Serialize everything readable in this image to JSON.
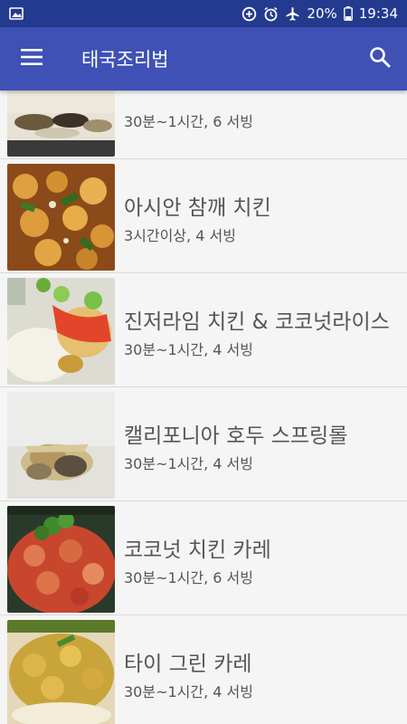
{
  "status_bar": {
    "battery": "20%",
    "time": "19:34",
    "icons": [
      "image-icon",
      "data-saver-icon",
      "alarm-icon",
      "airplane-icon",
      "battery-icon"
    ]
  },
  "app_bar": {
    "title": "태국조리법",
    "icons": [
      "menu-icon",
      "search-icon"
    ]
  },
  "recipes": [
    {
      "title": "",
      "subtitle": "30분~1시간, 6 서빙"
    },
    {
      "title": "아시안 참깨 치킨",
      "subtitle": "3시간이상, 4 서빙"
    },
    {
      "title": "진저라임 치킨 & 코코넛라이스",
      "subtitle": "30분~1시간, 4 서빙"
    },
    {
      "title": "캘리포니아 호두 스프링롤",
      "subtitle": "30분~1시간, 4 서빙"
    },
    {
      "title": "코코넛 치킨 카레",
      "subtitle": "30분~1시간, 6 서빙"
    },
    {
      "title": "타이 그린 카레",
      "subtitle": "30분~1시간, 4 서빙"
    }
  ],
  "colors": {
    "status_bar": "#243a8f",
    "app_bar": "#3f51b5",
    "background": "#f5f5f5",
    "text": "#555555"
  }
}
